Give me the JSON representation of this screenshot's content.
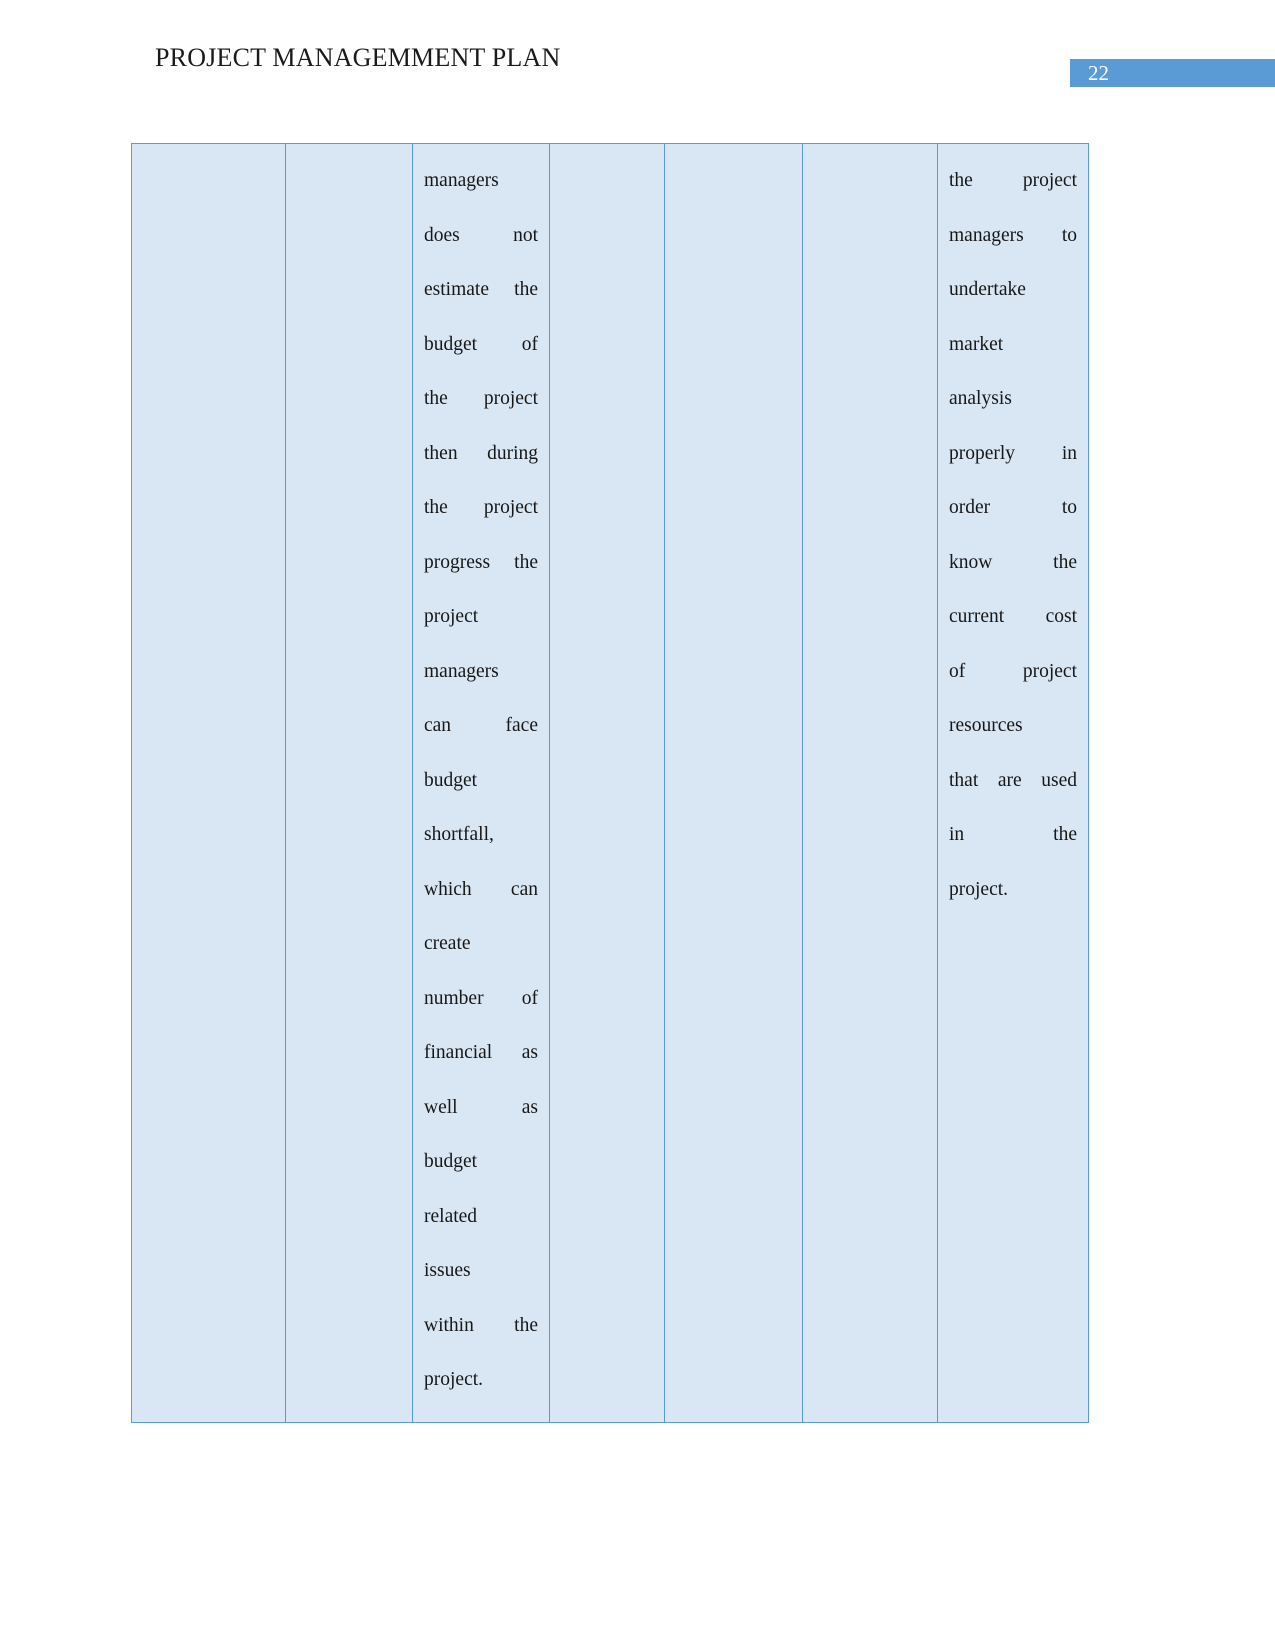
{
  "header": {
    "title": "PROJECT MANAGEMMENT PLAN",
    "page_number": "22",
    "banner_color": "#5b9bd5"
  },
  "table": {
    "fill_color": "#d9e6f3",
    "border_color": "#5b9bd5",
    "columns": 7,
    "cells": {
      "col1": "",
      "col2": "",
      "col3_lines": [
        "managers",
        "does not",
        "estimate the",
        "budget of",
        "the project",
        "then during",
        "the project",
        "progress the",
        "project",
        "managers",
        "can face",
        "budget",
        "shortfall,",
        "which can",
        "create",
        "number of",
        "financial as",
        "well as",
        "budget",
        "related",
        "issues",
        "within the",
        "project."
      ],
      "col3_text": "managers does not estimate the budget of the project then during the project progress the project managers can face budget shortfall, which can create number of financial as well as budget related issues within the project.",
      "col4": "",
      "col5": "",
      "col6": "",
      "col7_lines": [
        "the project",
        "managers to",
        "undertake",
        "market",
        "analysis",
        "properly in",
        "order to",
        "know the",
        "current cost",
        "of project",
        "resources",
        "that are used",
        "in the",
        "project."
      ],
      "col7_text": "the project managers to undertake market analysis properly in order to know the current cost of project resources that are used in the project."
    }
  }
}
